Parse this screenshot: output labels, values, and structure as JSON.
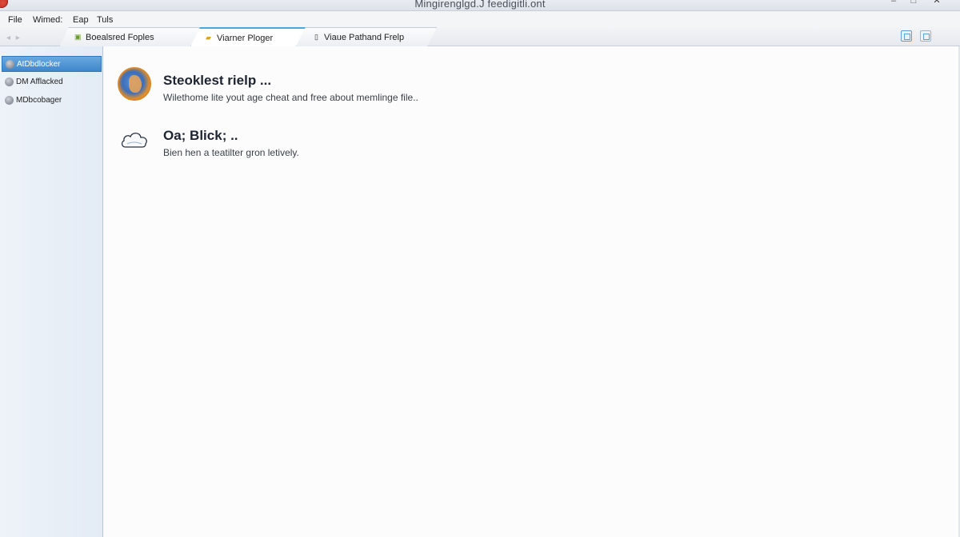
{
  "window": {
    "title": "Mingirenglgd.J feedigitli.ont"
  },
  "menu": {
    "file": "File",
    "wind": "Wimed:",
    "eap": "Eap",
    "tools": "Tuls"
  },
  "tabs": [
    {
      "label": "Boealsred Foples",
      "icon": "folder-icon"
    },
    {
      "label": "Viarner Ploger",
      "icon": "folder-icon"
    },
    {
      "label": "Viaue Pathand Frelp",
      "icon": "document-icon"
    }
  ],
  "sidebar": {
    "items": [
      {
        "label": "AtDbdlocker",
        "icon": "disk-icon",
        "selected": true
      },
      {
        "label": "DM Afflacked",
        "icon": "disk-icon",
        "selected": false
      },
      {
        "label": "MDbcobager",
        "icon": "disk-icon",
        "selected": false
      }
    ]
  },
  "main": {
    "entries": [
      {
        "title": "Steoklest rielp ...",
        "description": "Wilethome lite yout age cheat and free about memlinge file..",
        "icon": "globe-icon"
      },
      {
        "title": "Oa; Blick; ..",
        "description": "Bien hen a teatilter gron letively.",
        "icon": "cloud-icon"
      }
    ]
  },
  "colors": {
    "accent": "#4aa8d8",
    "selection": "#3e86cc",
    "sidebar_bg": "#e9f0f8"
  }
}
